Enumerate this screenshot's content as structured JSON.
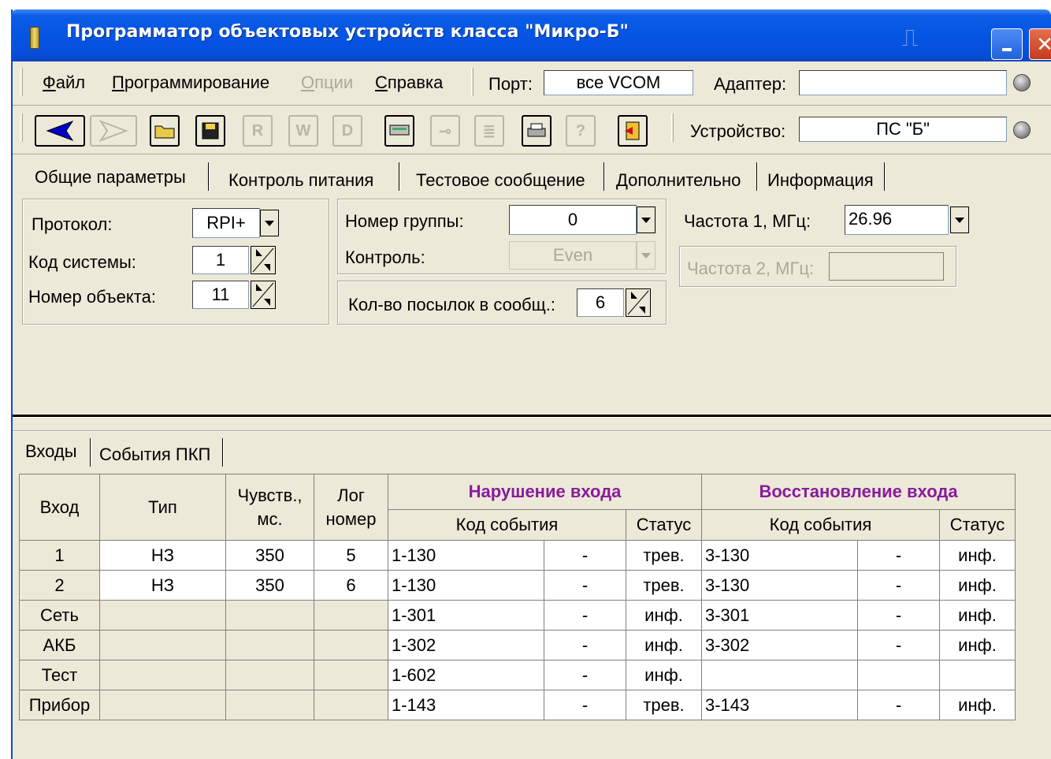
{
  "window": {
    "title": "Программатор объектовых устройств класса \"Микро-Б\""
  },
  "menu": {
    "file": "Файл",
    "programming": "Программирование",
    "options": "Опции",
    "help": "Справка"
  },
  "connection": {
    "port_label": "Порт:",
    "port_value": "все VCOM",
    "adapter_label": "Адаптер:",
    "adapter_value": "",
    "device_label": "Устройство:",
    "device_value": "ПС \"Б\""
  },
  "tabs": {
    "general": "Общие параметры",
    "power": "Контроль питания",
    "test_message": "Тестовое сообщение",
    "additional": "Дополнительно",
    "info": "Информация"
  },
  "general": {
    "protocol_label": "Протокол:",
    "protocol_value": "RPI+",
    "system_code_label": "Код системы:",
    "system_code_value": "1",
    "object_number_label": "Номер объекта:",
    "object_number_value": "11",
    "group_number_label": "Номер группы:",
    "group_number_value": "0",
    "control_label": "Контроль:",
    "control_value": "Even",
    "packets_label": "Кол-во посылок в сообщ.:",
    "packets_value": "6",
    "freq1_label": "Частота 1, МГц:",
    "freq1_value": "26.96",
    "freq2_label": "Частота 2, МГц:",
    "freq2_value": ""
  },
  "lower_tabs": {
    "inputs": "Входы",
    "events": "События ПКП"
  },
  "table": {
    "h_input": "Вход",
    "h_type": "Тип",
    "h_sens": "Чувств., мс.",
    "h_log": "Лог номер",
    "h_violation": "Нарушение входа",
    "h_restore": "Восстановление входа",
    "h_event_code": "Код события",
    "h_status": "Статус",
    "rows": [
      {
        "input": "1",
        "type": "НЗ",
        "sens": "350",
        "log": "5",
        "v_code": "1-130",
        "v_dash": "-",
        "v_status": "трев.",
        "r_code": "3-130",
        "r_dash": "-",
        "r_status": "инф."
      },
      {
        "input": "2",
        "type": "НЗ",
        "sens": "350",
        "log": "6",
        "v_code": "1-130",
        "v_dash": "-",
        "v_status": "трев.",
        "r_code": "3-130",
        "r_dash": "-",
        "r_status": "инф."
      },
      {
        "input": "Сеть",
        "type": "",
        "sens": "",
        "log": "",
        "v_code": "1-301",
        "v_dash": "-",
        "v_status": "инф.",
        "r_code": "3-301",
        "r_dash": "-",
        "r_status": "инф."
      },
      {
        "input": "АКБ",
        "type": "",
        "sens": "",
        "log": "",
        "v_code": "1-302",
        "v_dash": "-",
        "v_status": "инф.",
        "r_code": "3-302",
        "r_dash": "-",
        "r_status": "инф."
      },
      {
        "input": "Тест",
        "type": "",
        "sens": "",
        "log": "",
        "v_code": "1-602",
        "v_dash": "-",
        "v_status": "инф.",
        "r_code": "",
        "r_dash": "",
        "r_status": ""
      },
      {
        "input": "Прибор",
        "type": "",
        "sens": "",
        "log": "",
        "v_code": "1-143",
        "v_dash": "-",
        "v_status": "трев.",
        "r_code": "3-143",
        "r_dash": "-",
        "r_status": "инф."
      }
    ]
  },
  "colors": {
    "titlebar": "#0554e3",
    "face": "#ece9d8",
    "header_accent": "#8b1a9e"
  }
}
